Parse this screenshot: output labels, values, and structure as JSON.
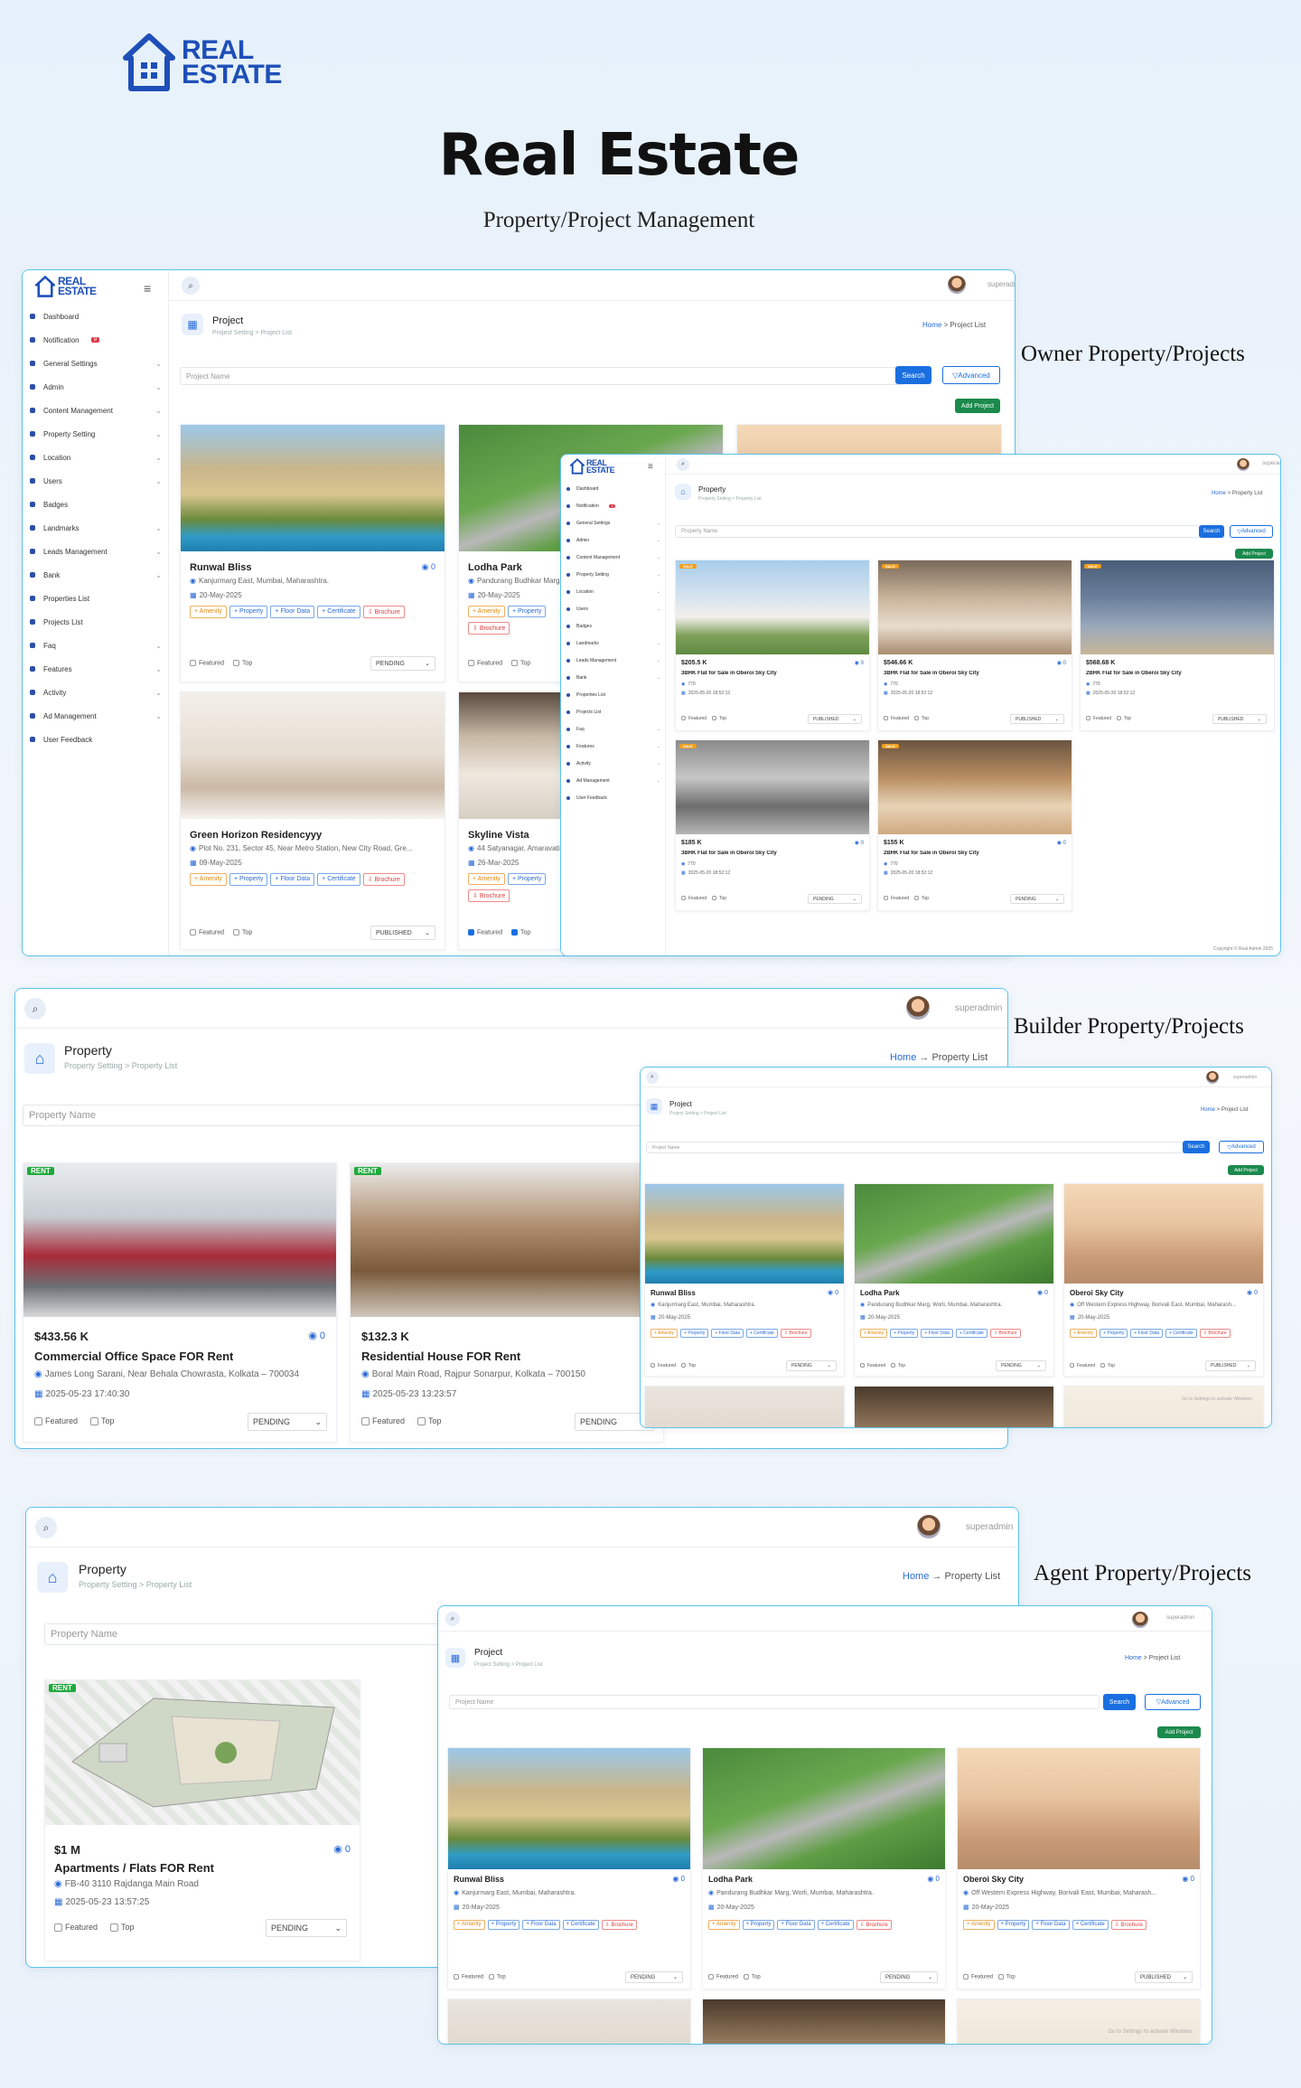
{
  "brand": {
    "logo_line1": "REAL",
    "logo_line2": "ESTATE"
  },
  "hero": {
    "title": "Real Estate",
    "subtitle": "Property/Project Management"
  },
  "labels": {
    "owner": "Owner Property/Projects",
    "builder": "Builder Property/Projects",
    "agent": "Agent Property/Projects"
  },
  "common": {
    "username": "superadmin",
    "search_btn": "Search",
    "advanced_btn": "Advanced",
    "add_project_btn": "Add Project",
    "home": "Home",
    "arrow": "→",
    "featured": "Featured",
    "top": "Top",
    "copyright": "Copyright © Real Admin 2025"
  },
  "sidebar": {
    "items": [
      {
        "label": "Dashboard",
        "chev": ""
      },
      {
        "label": "Notification",
        "chev": "",
        "badge": "9"
      },
      {
        "label": "General Settings",
        "chev": "⌄"
      },
      {
        "label": "Admin",
        "chev": "⌄"
      },
      {
        "label": "Content Management",
        "chev": "⌄"
      },
      {
        "label": "Property Setting",
        "chev": "⌄"
      },
      {
        "label": "Location",
        "chev": "⌄"
      },
      {
        "label": "Users",
        "chev": "⌄"
      },
      {
        "label": "Badges",
        "chev": ""
      },
      {
        "label": "Landmarks",
        "chev": "⌄"
      },
      {
        "label": "Leads Management",
        "chev": "⌄"
      },
      {
        "label": "Bank",
        "chev": "⌄"
      },
      {
        "label": "Properties List",
        "chev": ""
      },
      {
        "label": "Projects List",
        "chev": ""
      },
      {
        "label": "Faq",
        "chev": "⌄"
      },
      {
        "label": "Features",
        "chev": "⌄"
      },
      {
        "label": "Activity",
        "chev": "⌄"
      },
      {
        "label": "Ad Management",
        "chev": "⌄"
      },
      {
        "label": "User Feedback",
        "chev": ""
      }
    ]
  },
  "project_page": {
    "title": "Project",
    "crumb": "Project Setting  >  Project List",
    "crumb_right": "Project List",
    "search_placeholder": "Project Name"
  },
  "property_page": {
    "title": "Property",
    "crumb": "Property Setting  >  Property List",
    "crumb_right": "Property List",
    "search_placeholder": "Property Name"
  },
  "project_cards": [
    {
      "title": "Runwal Bliss",
      "address": "Kanjurmarg East, Mumbai, Maharashtra.",
      "date": "20-May-2025",
      "count": "0",
      "status": "PENDING"
    },
    {
      "title": "Lodha Park",
      "address": "Pandurang Budhkar Marg, Worli, Mumbai, Maharashtra.",
      "date": "20-May-2025",
      "count": "0",
      "status": "PENDING"
    },
    {
      "title": "Oberoi Sky City",
      "address": "Off Western Express Highway, Borivali East, Mumbai, Maharash...",
      "date": "20-May-2025",
      "count": "0",
      "status": "PUBLISHED"
    },
    {
      "title": "Green Horizon Residencyyy",
      "address": "Plot No. 231, Sector 45, Near Metro Station, New City Road, Gre...",
      "date": "09-May-2025",
      "count": "",
      "status": "PUBLISHED"
    },
    {
      "title": "Skyline Vista",
      "address": "44 Satyanagar, Amaravati...",
      "date": "26-Mar-2025",
      "count": "",
      "status": ""
    }
  ],
  "chips": {
    "amenity": "+ Amenity",
    "property": "+ Property",
    "floor": "+ Floor Data",
    "certificate": "+ Certificate",
    "brochure": "Brochure"
  },
  "owner_props": [
    {
      "tag": "SALE",
      "price": "$205.5 K",
      "title": "3BHK Flat for Sale in Oberoi Sky City",
      "sub": "770",
      "date": "2025-05-20 18:52:12",
      "count": "0",
      "status": "PUBLISHED"
    },
    {
      "tag": "SALE",
      "price": "$546.66 K",
      "title": "3BHK Flat for Sale in Oberoi Sky City",
      "sub": "770",
      "date": "2025-05-20 18:52:12",
      "count": "0",
      "status": "PUBLISHED"
    },
    {
      "tag": "SALE",
      "price": "$568.68 K",
      "title": "2BHK Flat for Sale in Oberoi Sky City",
      "sub": "770",
      "date": "2025-05-20 18:52:12",
      "count": "",
      "status": "PUBLISHED"
    },
    {
      "tag": "SALE",
      "price": "$185 K",
      "title": "3BHK Flat for Sale in Oberoi Sky City",
      "sub": "770",
      "date": "2025-05-20 18:52:12",
      "count": "0",
      "status": "PENDING"
    },
    {
      "tag": "SALE",
      "price": "$155 K",
      "title": "2BHK Flat for Sale in Oberoi Sky City",
      "sub": "770",
      "date": "2025-05-20 18:52:12",
      "count": "0",
      "status": "PENDING"
    }
  ],
  "builder_props": [
    {
      "tag": "RENT",
      "price": "$433.56 K",
      "title": "Commercial Office Space FOR Rent",
      "address": "James Long Sarani, Near Behala Chowrasta, Kolkata – 700034",
      "date": "2025-05-23 17:40:30",
      "count": "0",
      "status": "PENDING"
    },
    {
      "tag": "RENT",
      "price": "$132.3 K",
      "title": "Residential House FOR Rent",
      "address": "Boral Main Road, Rajpur Sonarpur, Kolkata – 700150",
      "date": "2025-05-23 13:23:57",
      "count": "",
      "status": "PENDING"
    }
  ],
  "agent_prop": {
    "tag": "RENT",
    "price": "$1 M",
    "title": "Apartments / Flats FOR Rent",
    "address": "FB-40 3110 Rajdanga Main Road",
    "date": "2025-05-23 13:57:25",
    "count": "0",
    "status": "PENDING"
  },
  "activate": "Go to Settings to activate Windows."
}
